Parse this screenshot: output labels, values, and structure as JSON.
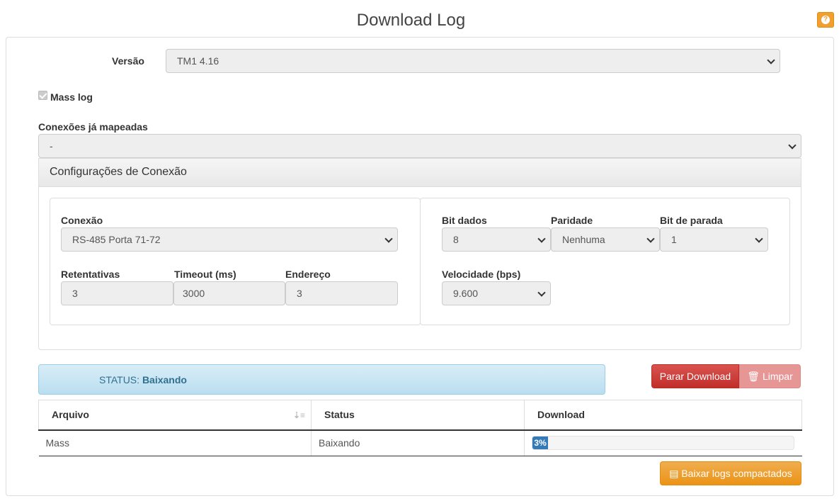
{
  "title": "Download Log",
  "versao": {
    "label": "Versão",
    "value": "TM1 4.16"
  },
  "mass_log": {
    "label": "Mass log",
    "checked": true
  },
  "conexoes": {
    "label": "Conexões já mapeadas",
    "value": "-"
  },
  "config": {
    "heading": "Configurações de Conexão",
    "conexao": {
      "label": "Conexão",
      "value": "RS-485 Porta 71-72"
    },
    "retentativas": {
      "label": "Retentativas",
      "value": "3"
    },
    "timeout": {
      "label": "Timeout (ms)",
      "value": "3000"
    },
    "endereco": {
      "label": "Endereço",
      "value": "3"
    },
    "bit_dados": {
      "label": "Bit dados",
      "value": "8"
    },
    "paridade": {
      "label": "Paridade",
      "value": "Nenhuma"
    },
    "bit_parada": {
      "label": "Bit de parada",
      "value": "1"
    },
    "velocidade": {
      "label": "Velocidade (bps)",
      "value": "9.600"
    }
  },
  "status": {
    "prefix": "STATUS:",
    "value": "Baixando"
  },
  "buttons": {
    "stop": "Parar Download",
    "clear": "Limpar",
    "zip": "Baixar logs compactados"
  },
  "table": {
    "headers": [
      "Arquivo",
      "Status",
      "Download"
    ],
    "rows": [
      {
        "arquivo": "Mass",
        "status": "Baixando",
        "progress_percent": 3,
        "progress_label": "3%"
      }
    ]
  },
  "colors": {
    "accent_orange": "#f0ad4e",
    "danger": "#d9534f",
    "progress": "#337ab7",
    "info_bg": "#d9edf7"
  }
}
